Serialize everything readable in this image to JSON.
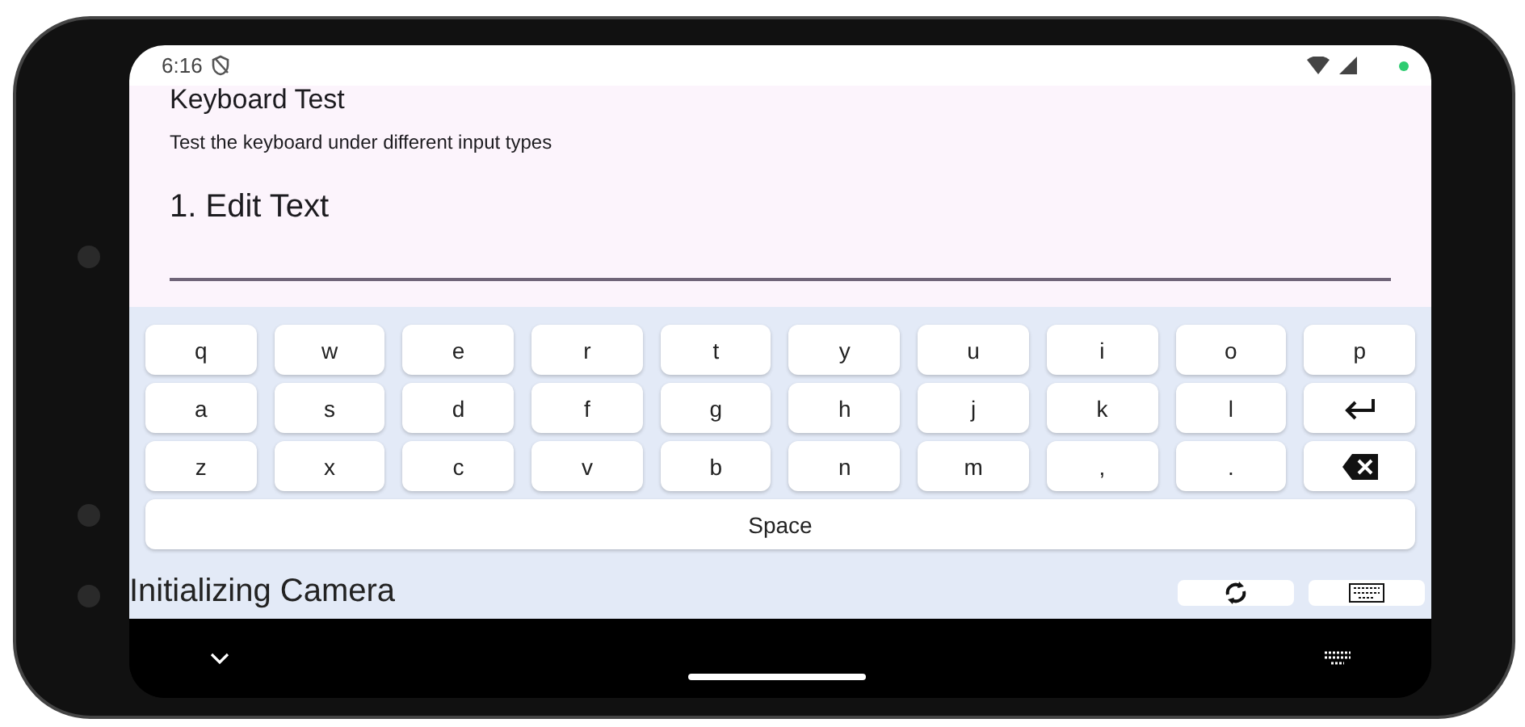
{
  "status_bar": {
    "time": "6:16"
  },
  "page": {
    "title": "Keyboard Test",
    "subtitle": "Test the keyboard under different input types",
    "section": "1. Edit Text"
  },
  "keyboard": {
    "rows": [
      [
        {
          "kind": "char",
          "label": "q"
        },
        {
          "kind": "char",
          "label": "w"
        },
        {
          "kind": "char",
          "label": "e"
        },
        {
          "kind": "char",
          "label": "r"
        },
        {
          "kind": "char",
          "label": "t"
        },
        {
          "kind": "char",
          "label": "y"
        },
        {
          "kind": "char",
          "label": "u"
        },
        {
          "kind": "char",
          "label": "i"
        },
        {
          "kind": "char",
          "label": "o"
        },
        {
          "kind": "char",
          "label": "p"
        }
      ],
      [
        {
          "kind": "char",
          "label": "a"
        },
        {
          "kind": "char",
          "label": "s"
        },
        {
          "kind": "char",
          "label": "d"
        },
        {
          "kind": "char",
          "label": "f"
        },
        {
          "kind": "char",
          "label": "g"
        },
        {
          "kind": "char",
          "label": "h"
        },
        {
          "kind": "char",
          "label": "j"
        },
        {
          "kind": "char",
          "label": "k"
        },
        {
          "kind": "char",
          "label": "l"
        },
        {
          "kind": "enter"
        }
      ],
      [
        {
          "kind": "char",
          "label": "z"
        },
        {
          "kind": "char",
          "label": "x"
        },
        {
          "kind": "char",
          "label": "c"
        },
        {
          "kind": "char",
          "label": "v"
        },
        {
          "kind": "char",
          "label": "b"
        },
        {
          "kind": "char",
          "label": "n"
        },
        {
          "kind": "char",
          "label": "m"
        },
        {
          "kind": "char",
          "label": ","
        },
        {
          "kind": "char",
          "label": "."
        },
        {
          "kind": "backspace"
        }
      ],
      [
        {
          "kind": "space",
          "label": "Space"
        }
      ]
    ]
  },
  "camera_status": "Initializing Camera"
}
